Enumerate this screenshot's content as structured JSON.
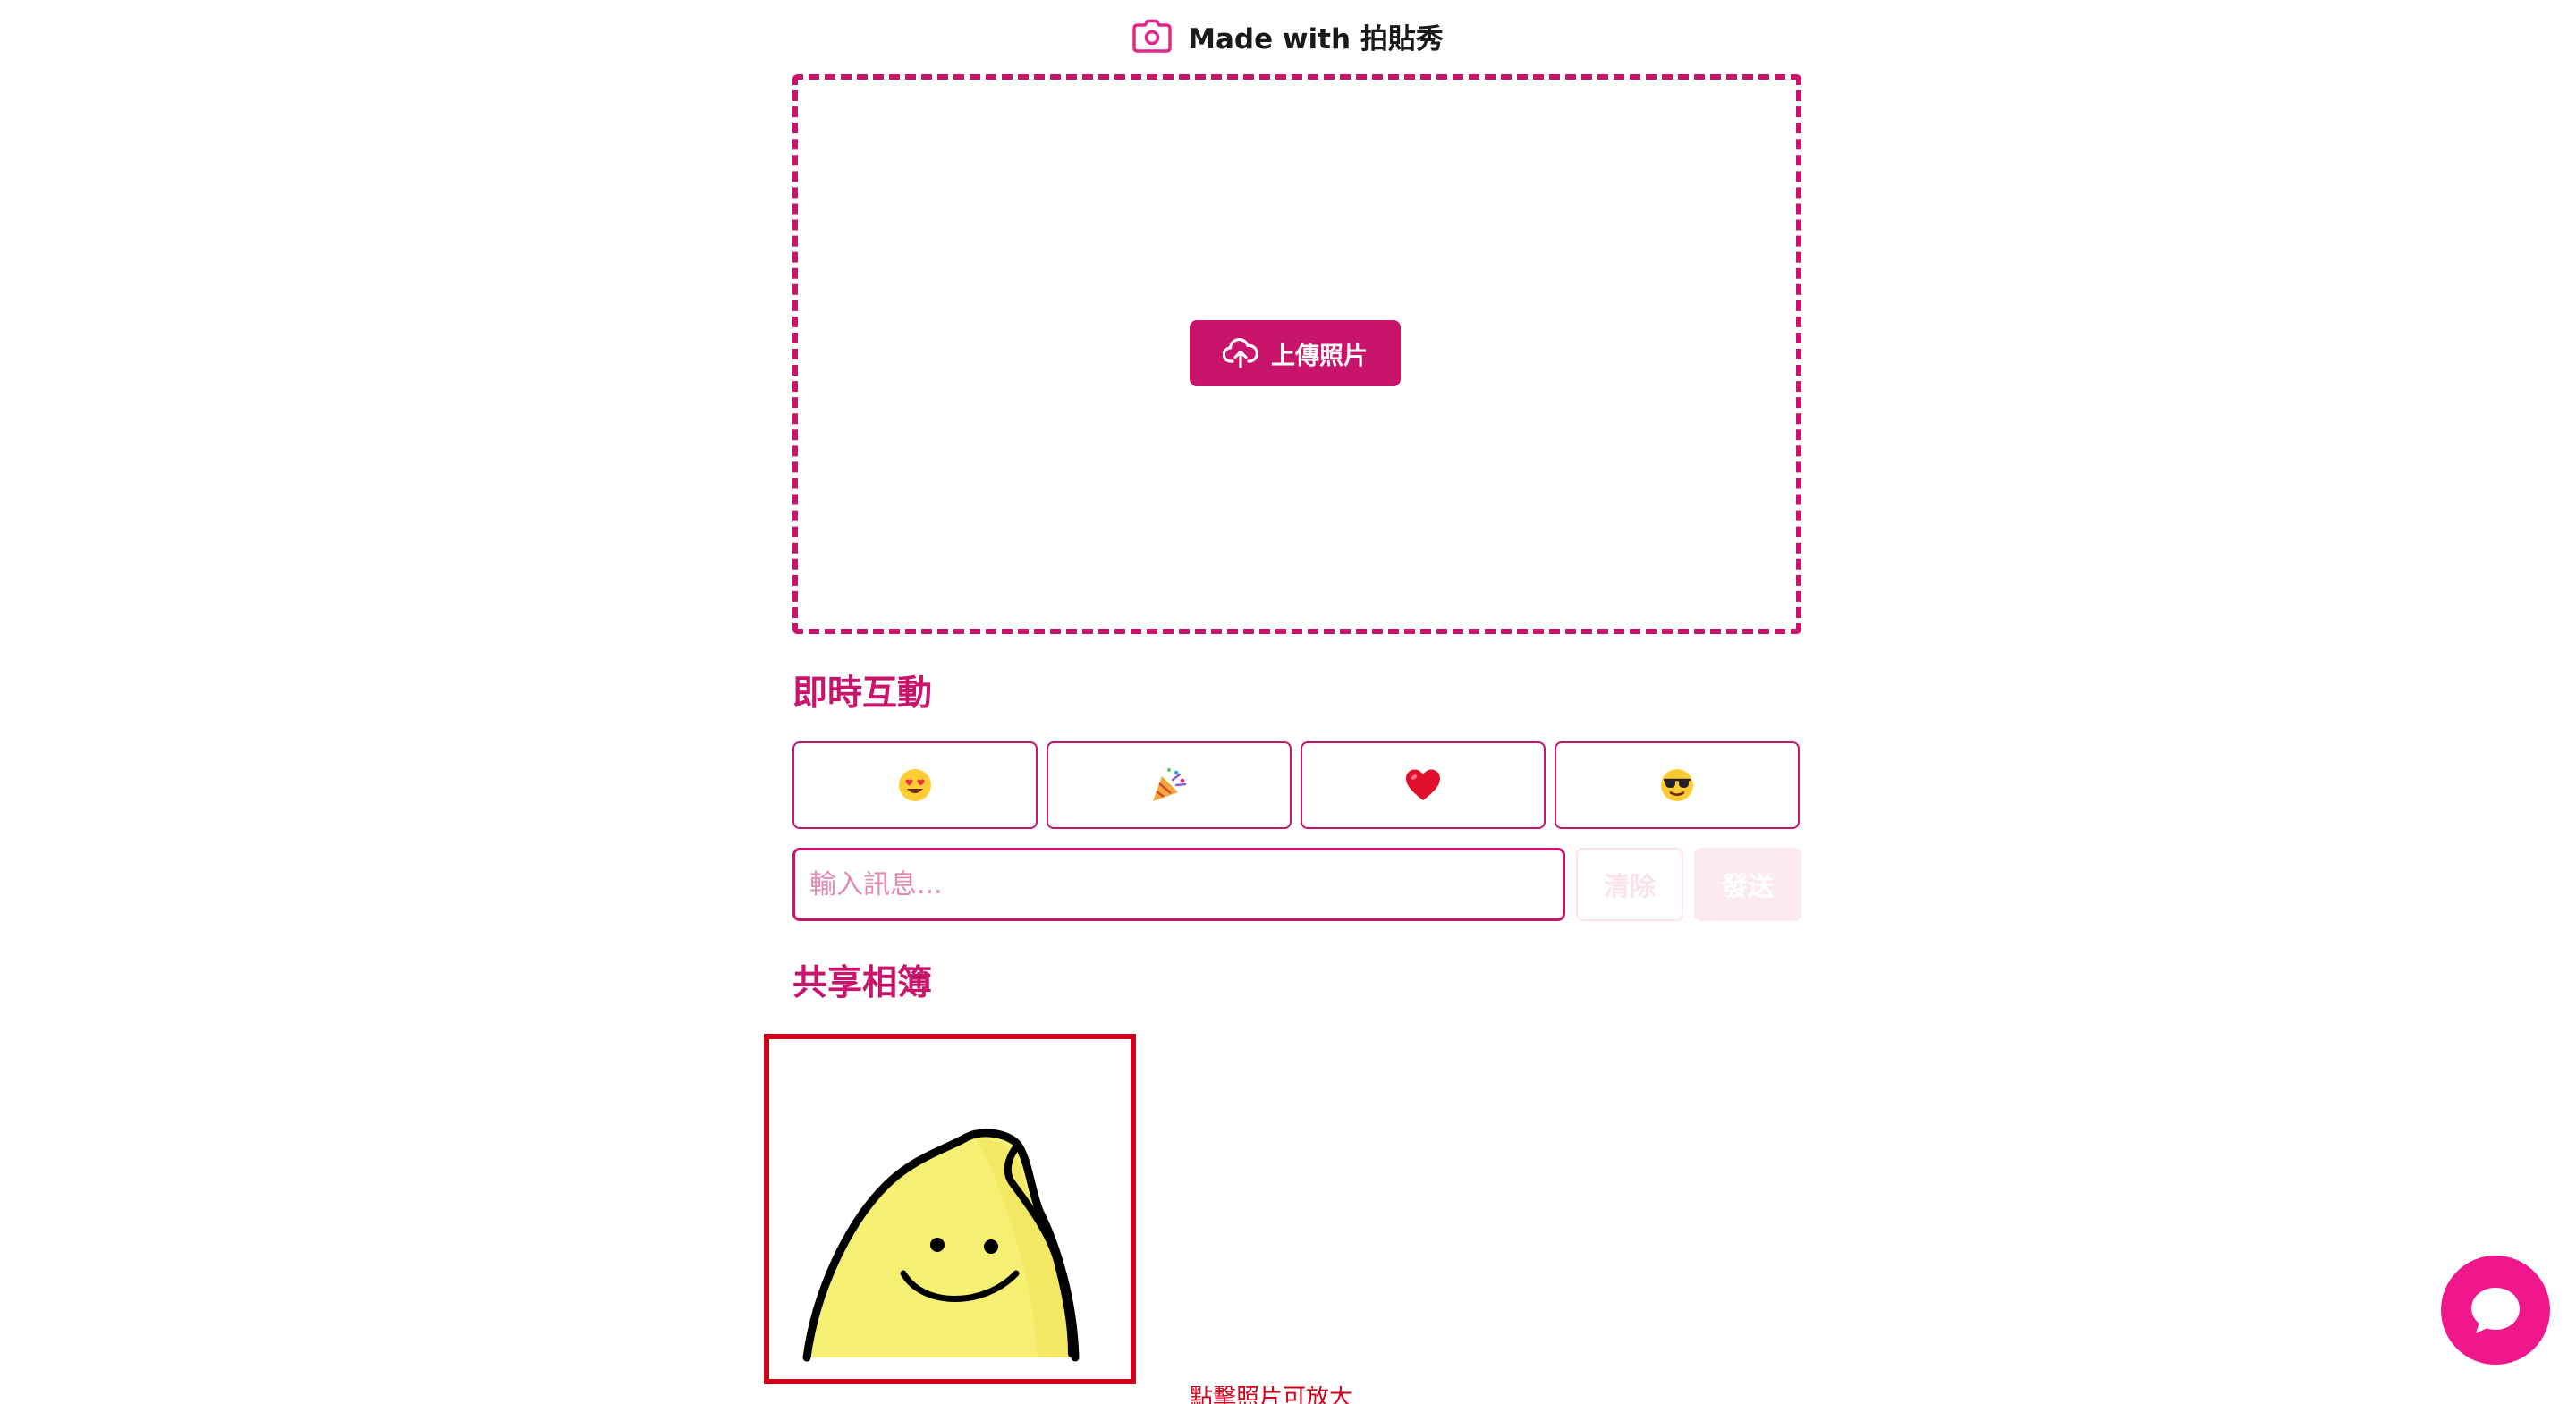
{
  "header": {
    "title": "Made with 拍貼秀",
    "icon": "camera-icon"
  },
  "upload": {
    "button_label": "上傳照片",
    "icon": "cloud-upload-icon"
  },
  "reactions": {
    "title": "即時互動",
    "items": [
      {
        "emoji": "😍",
        "icon": "heart-eyes-emoji"
      },
      {
        "emoji": "🎉",
        "icon": "party-popper-emoji"
      },
      {
        "emoji": "❤️",
        "icon": "red-heart-emoji"
      },
      {
        "emoji": "😎",
        "icon": "sunglasses-emoji"
      }
    ]
  },
  "message": {
    "placeholder": "輸入訊息...",
    "value": "",
    "clear_label": "清除",
    "send_label": "發送"
  },
  "album": {
    "title": "共享相簿",
    "hint": "點擊照片可放大"
  },
  "chat": {
    "icon": "chat-bubble-icon"
  },
  "colors": {
    "accent": "#c8146a",
    "fab": "#f0168c",
    "selected_border": "#d0021b"
  }
}
